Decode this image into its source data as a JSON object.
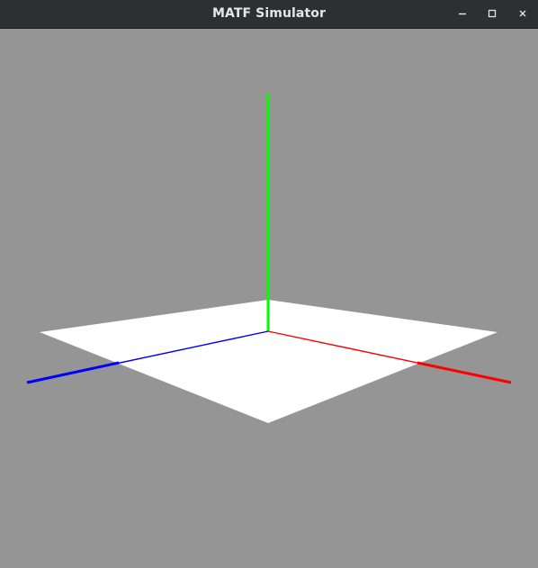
{
  "window": {
    "title": "MATF Simulator",
    "controls": {
      "minimize_icon": "minimize-icon",
      "maximize_icon": "maximize-icon",
      "close_icon": "close-icon"
    }
  },
  "scene": {
    "background_color": "#959595",
    "plane_color": "#ffffff",
    "axes": {
      "x_color": "#ff0000",
      "y_color": "#00ff00",
      "z_color": "#0000ff"
    }
  }
}
